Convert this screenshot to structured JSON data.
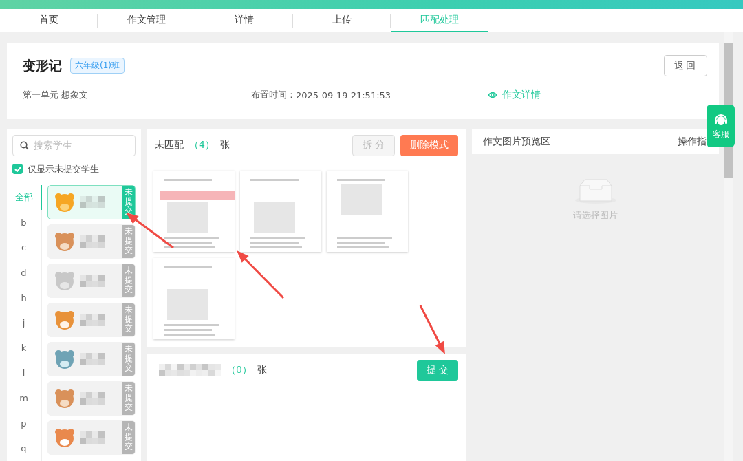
{
  "nav": {
    "tabs": [
      {
        "label": "首页",
        "selected": false
      },
      {
        "label": "作文管理",
        "selected": false
      },
      {
        "label": "详情",
        "selected": false
      },
      {
        "label": "上传",
        "selected": false
      },
      {
        "label": "匹配处理",
        "selected": true
      }
    ]
  },
  "header": {
    "title": "变形记",
    "class_tag": "六年级(1)班",
    "back_button": "返回",
    "unit": "第一单元 想象文",
    "assigned_label": "布置时间：",
    "assigned_time": "2025-09-19 21:51:53",
    "details_link": "作文详情"
  },
  "students_panel": {
    "search": {
      "placeholder": "搜索学生"
    },
    "filter": {
      "label": "仅显示未提交学生",
      "checked": true
    },
    "letters": [
      {
        "label": "全部",
        "selected": true
      },
      {
        "label": "b",
        "selected": false
      },
      {
        "label": "c",
        "selected": false
      },
      {
        "label": "d",
        "selected": false
      },
      {
        "label": "h",
        "selected": false
      },
      {
        "label": "j",
        "selected": false
      },
      {
        "label": "k",
        "selected": false
      },
      {
        "label": "l",
        "selected": false
      },
      {
        "label": "m",
        "selected": false
      },
      {
        "label": "p",
        "selected": false
      },
      {
        "label": "q",
        "selected": false
      }
    ],
    "students": [
      {
        "kind": "lion",
        "status": "未提交",
        "selected": true
      },
      {
        "kind": "bear",
        "status": "未提交",
        "selected": false
      },
      {
        "kind": "koala",
        "status": "未提交",
        "selected": false
      },
      {
        "kind": "tiger",
        "status": "未提交",
        "selected": false
      },
      {
        "kind": "owl",
        "status": "未提交",
        "selected": false
      },
      {
        "kind": "bear",
        "status": "未提交",
        "selected": false
      },
      {
        "kind": "fox",
        "status": "未提交",
        "selected": false
      }
    ]
  },
  "unmatched": {
    "title": "未匹配",
    "count": "（4）",
    "unit": "张",
    "split_button": {
      "label": "拆 分",
      "disabled": true
    },
    "delete_button": "删除模式"
  },
  "matched": {
    "count": "（0）",
    "unit": "张",
    "submit_button": "提 交"
  },
  "preview": {
    "title": "作文图片预览区",
    "guide": "操作指",
    "empty_text": "请选择图片"
  },
  "support": {
    "label": "客服"
  }
}
